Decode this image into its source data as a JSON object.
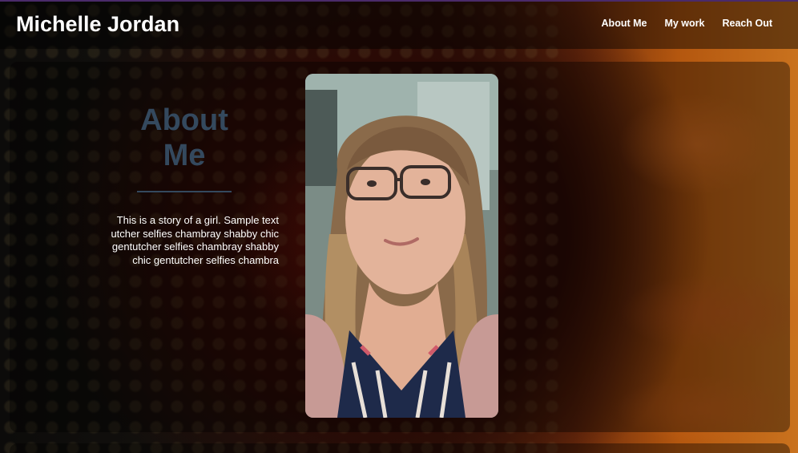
{
  "header": {
    "brand": "Michelle Jordan",
    "nav": [
      "About Me",
      "My work",
      "Reach Out"
    ]
  },
  "about": {
    "title": "About Me",
    "body": "This is a story of a girl. Sample text utcher selfies chambray shabby chic gentutcher selfies chambray shabby chic gentutcher selfies chambra"
  },
  "photo": {
    "alt": "Portrait photo of Michelle Jordan wearing glasses"
  },
  "colors": {
    "heading": "#34495e",
    "text": "#ffffff",
    "accent_orange": "#c9721e"
  }
}
